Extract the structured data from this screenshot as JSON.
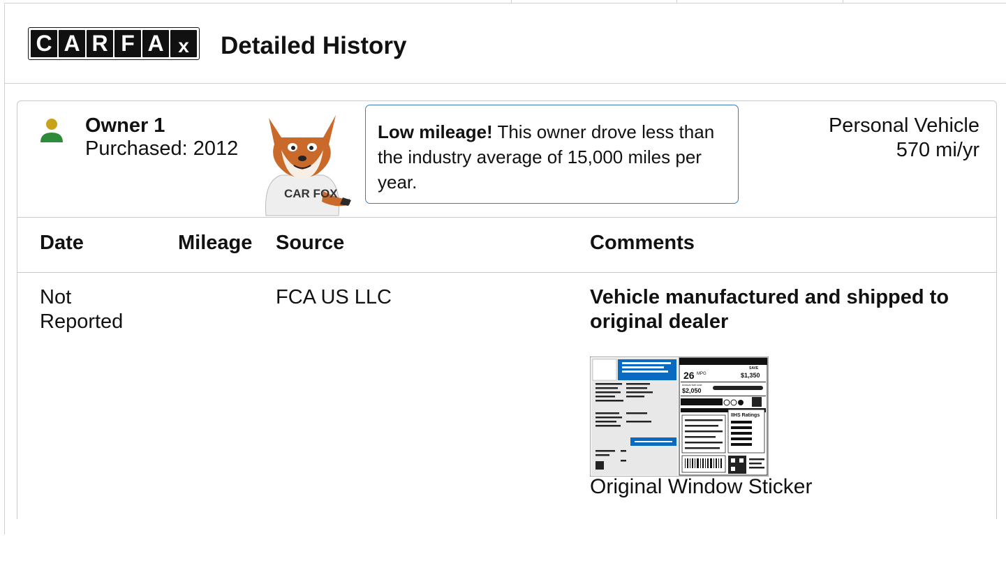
{
  "header": {
    "logo_letters": [
      "C",
      "A",
      "R",
      "F",
      "A",
      "X"
    ],
    "title": "Detailed History"
  },
  "owner": {
    "name": "Owner 1",
    "purchased": "Purchased: 2012",
    "mascot_shirt": "CAR FOX",
    "callout_bold": "Low mileage!",
    "callout_text": " This owner drove less than the industry average of 15,000 miles per year.",
    "vehicle_type": "Personal Vehicle",
    "mileage_rate": "570 mi/yr"
  },
  "table": {
    "columns": [
      "Date",
      "Mileage",
      "Source",
      "Comments"
    ],
    "rows": [
      {
        "date": "Not Reported",
        "mileage": "",
        "source": "FCA US LLC",
        "comment_title": "Vehicle manufactured and shipped to original dealer",
        "attachment_label": "Original Window Sticker"
      }
    ]
  },
  "sticker": {
    "mpg": "26",
    "mpg_unit": "MPG",
    "save": "SAVE",
    "save_amount": "$1,350",
    "annual_cost_label": "Annual fuel cost",
    "annual_cost": "$2,050",
    "iihs": "IIHS Ratings"
  },
  "colors": {
    "accent_blue": "#0a6ac0",
    "callout_border": "#3a7bbf",
    "person_head": "#c8a21a",
    "person_body": "#2e8b3a"
  }
}
